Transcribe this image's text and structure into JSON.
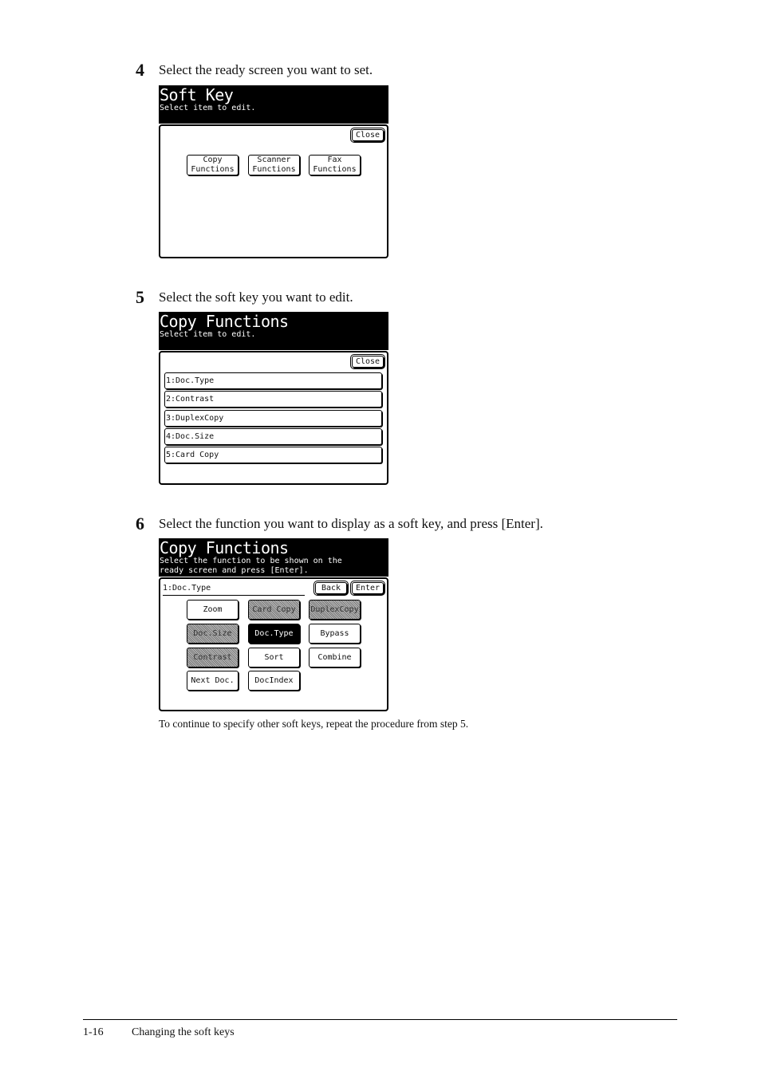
{
  "steps": [
    {
      "number": "4",
      "text": "Select the ready screen you want to set."
    },
    {
      "number": "5",
      "text": "Select the soft key you want to edit."
    },
    {
      "number": "6",
      "text": "Select the function you want to display as a soft key, and press [Enter]."
    }
  ],
  "screen1": {
    "title": "Soft Key",
    "subtitle": "Select item to edit.",
    "close": "Close",
    "buttons": [
      {
        "l1": "Copy",
        "l2": "Functions"
      },
      {
        "l1": "Scanner",
        "l2": "Functions"
      },
      {
        "l1": "Fax",
        "l2": "Functions"
      }
    ]
  },
  "screen2": {
    "title": "Copy Functions",
    "subtitle": "Select item to edit.",
    "close": "Close",
    "items": [
      "1:Doc.Type",
      "2:Contrast",
      "3:DuplexCopy",
      "4:Doc.Size",
      "5:Card Copy"
    ]
  },
  "screen3": {
    "title": "Copy Functions",
    "subtitle1": "Select the function to be shown on the",
    "subtitle2": "ready screen and press [Enter].",
    "field": "1:Doc.Type",
    "back": "Back",
    "enter": "Enter",
    "grid": [
      {
        "label": "Zoom",
        "state": "normal"
      },
      {
        "label": "Card Copy",
        "state": "disabled"
      },
      {
        "label": "DuplexCopy",
        "state": "disabled"
      },
      {
        "label": "Doc.Size",
        "state": "disabled"
      },
      {
        "label": "Doc.Type",
        "state": "selected"
      },
      {
        "label": "Bypass",
        "state": "normal"
      },
      {
        "label": "Contrast",
        "state": "disabled"
      },
      {
        "label": "Sort",
        "state": "normal"
      },
      {
        "label": "Combine",
        "state": "normal"
      },
      {
        "label": "Next Doc.",
        "state": "normal"
      },
      {
        "label": "DocIndex",
        "state": "normal"
      }
    ]
  },
  "note": "To continue to specify other soft keys, repeat the procedure from step 5.",
  "footer": {
    "page": "1-16",
    "section": "Changing the soft keys"
  }
}
